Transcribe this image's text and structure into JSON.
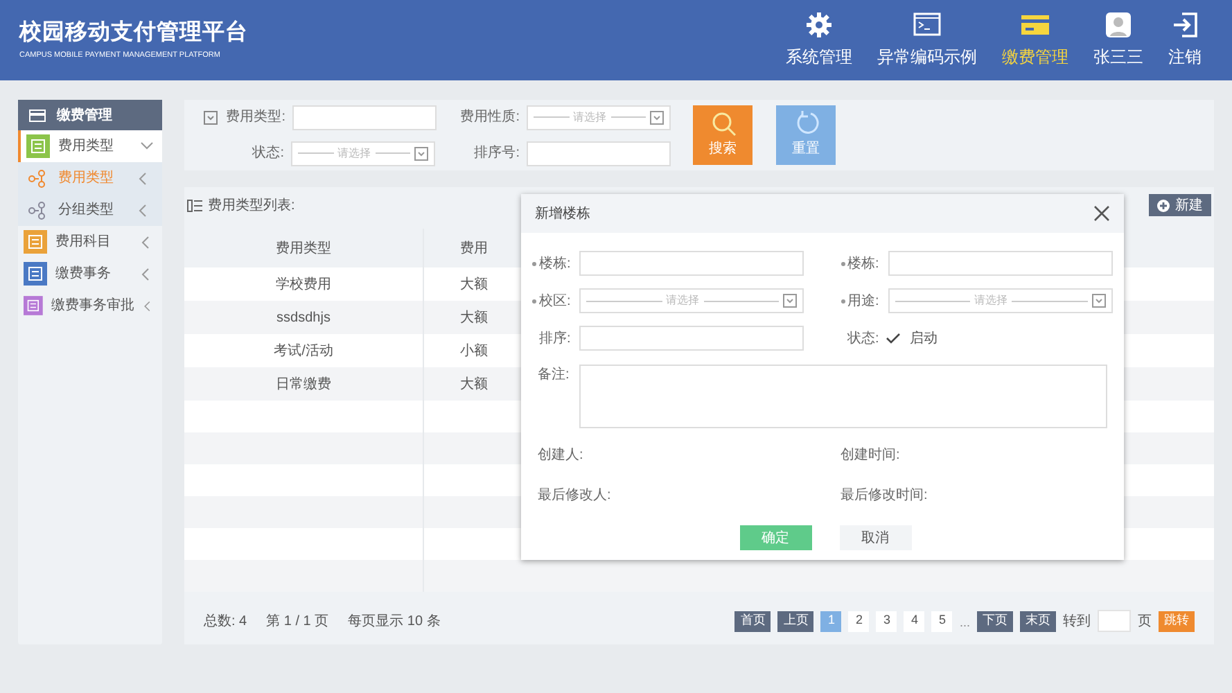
{
  "app": {
    "title": "校园移动支付管理平台",
    "subtitle": "CAMPUS MOBILE PAYMENT MANAGEMENT PLATFORM"
  },
  "nav": [
    {
      "label": "系统管理",
      "kind": "gear",
      "selected": false
    },
    {
      "label": "异常编码示例",
      "kind": "terminal",
      "selected": false
    },
    {
      "label": "缴费管理",
      "kind": "card",
      "selected": true
    },
    {
      "label": "张三三",
      "kind": "avatar",
      "selected": false
    },
    {
      "label": "注销",
      "kind": "logout",
      "selected": false
    }
  ],
  "sidebar": {
    "title": "缴费管理",
    "items": [
      {
        "label": "费用类型",
        "kind": "tags",
        "expanded": true,
        "children": [
          {
            "label": "费用类型",
            "selected": true
          },
          {
            "label": "分组类型",
            "selected": false
          }
        ]
      },
      {
        "label": "费用科目",
        "kind": "ledger",
        "expanded": false
      },
      {
        "label": "缴费事务",
        "kind": "receipt",
        "expanded": false
      },
      {
        "label": "缴费事务审批",
        "kind": "approval",
        "expanded": false
      }
    ]
  },
  "search": {
    "fields": [
      {
        "label": "费用类型:",
        "kind": "text"
      },
      {
        "label": "费用性质:",
        "kind": "select",
        "placeholder": "请选择"
      },
      {
        "label": "状态:",
        "kind": "select",
        "placeholder": "请选择"
      },
      {
        "label": "排序号:",
        "kind": "text"
      }
    ],
    "buttons": [
      {
        "label": "搜索",
        "kind": "search"
      },
      {
        "label": "重置",
        "kind": "reset"
      }
    ]
  },
  "list": {
    "title": "费用类型列表:",
    "new_button": "新建",
    "columns": [
      "费用类型",
      "费用"
    ],
    "rows": [
      [
        "学校费用",
        "大额"
      ],
      [
        "ssdsdhjs",
        "大额"
      ],
      [
        "考试/活动",
        "小额"
      ],
      [
        "日常缴费",
        "大额"
      ]
    ]
  },
  "pagination": {
    "total": "总数: 4",
    "page": "第 1 / 1 页",
    "per_page": "每页显示 10 条",
    "first": "首页",
    "prev": "上页",
    "pages": [
      {
        "label": "1",
        "selected": true
      },
      {
        "label": "2",
        "selected": false
      },
      {
        "label": "3",
        "selected": false
      },
      {
        "label": "4",
        "selected": false
      },
      {
        "label": "5",
        "selected": false
      }
    ],
    "ellipsis": "...",
    "next": "下页",
    "last": "末页",
    "goto_label": "转到",
    "page_unit": "页",
    "jump": "跳转"
  },
  "dialog": {
    "title": "新增楼栋",
    "fields": [
      {
        "label": "楼栋:",
        "kind": "text",
        "required": true
      },
      {
        "label": "楼栋:",
        "kind": "text",
        "required": true
      },
      {
        "label": "校区:",
        "kind": "select",
        "required": true,
        "placeholder": "请选择"
      },
      {
        "label": "用途:",
        "kind": "select",
        "required": true,
        "placeholder": "请选择"
      },
      {
        "label": "排序:",
        "kind": "text",
        "required": false
      },
      {
        "label": "状态:",
        "kind": "checkbox",
        "required": false,
        "checked": true,
        "option": "启动"
      }
    ],
    "remark_label": "备注:",
    "info": [
      "创建人:",
      "创建时间:",
      "最后修改人:",
      "最后修改时间:"
    ],
    "ok": "确定",
    "cancel": "取消"
  }
}
